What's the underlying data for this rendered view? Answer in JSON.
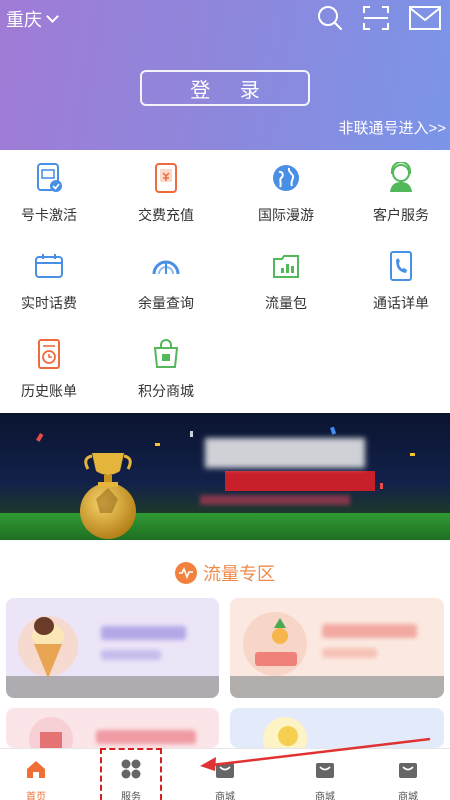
{
  "header": {
    "city": "重庆",
    "login_label": "登 录",
    "non_unicom_link": "非联通号进入>>",
    "icons": [
      "search-icon",
      "scan-icon",
      "mail-icon"
    ]
  },
  "services": [
    {
      "label": "号卡激活",
      "icon": "sim-activate-icon"
    },
    {
      "label": "交费充值",
      "icon": "recharge-icon"
    },
    {
      "label": "国际漫游",
      "icon": "globe-icon"
    },
    {
      "label": "客户服务",
      "icon": "customer-service-icon"
    },
    {
      "label": "实时话费",
      "icon": "realtime-bill-icon"
    },
    {
      "label": "余量查询",
      "icon": "gauge-icon"
    },
    {
      "label": "流量包",
      "icon": "data-pack-icon"
    },
    {
      "label": "通话详单",
      "icon": "call-detail-icon"
    },
    {
      "label": "历史账单",
      "icon": "history-bill-icon"
    },
    {
      "label": "积分商城",
      "icon": "points-mall-icon"
    }
  ],
  "banner": {
    "icon": "trophy-football-banner"
  },
  "section": {
    "title": "流量专区",
    "icon": "waveform-icon"
  },
  "cards": [
    {
      "title": "",
      "icon": "ice-cream-icon"
    },
    {
      "title": "",
      "icon": "pineapple-icon"
    },
    {
      "title": "",
      "icon": "promo-icon"
    },
    {
      "title": "",
      "icon": "coin-icon"
    }
  ],
  "nav": {
    "items": [
      {
        "label": "首页",
        "icon": "home-icon",
        "active": true
      },
      {
        "label": "服务",
        "icon": "service-grid-icon",
        "active": false
      },
      {
        "label": "商城",
        "icon": "shop-icon",
        "active": false
      },
      {
        "label": "商城",
        "icon": "shop-icon",
        "active": false
      },
      {
        "label": "商城",
        "icon": "shop-icon",
        "active": false
      }
    ]
  },
  "colors": {
    "accent_orange": "#f06f36",
    "header_start": "#a07bd6",
    "header_end": "#7b95e8",
    "highlight_red": "#d42020"
  }
}
